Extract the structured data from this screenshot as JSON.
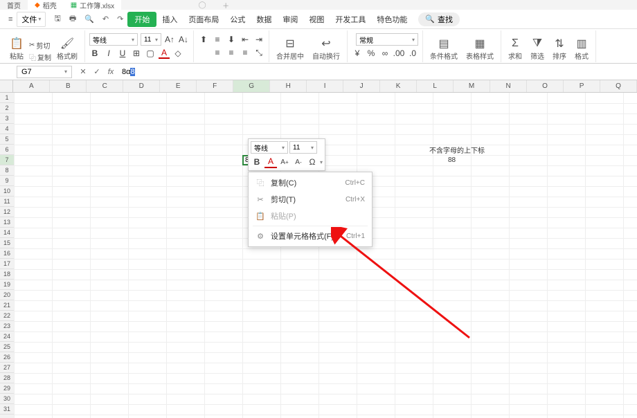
{
  "top_tabs": {
    "home": "首页",
    "daoke": "稻壳",
    "workbook": "工作簿.xlsx"
  },
  "menu": {
    "file": "文件",
    "start": "开始",
    "insert": "插入",
    "page_layout": "页面布局",
    "formulas": "公式",
    "data": "数据",
    "review": "审阅",
    "view": "视图",
    "dev_tools": "开发工具",
    "special": "特色功能",
    "search": "查找"
  },
  "ribbon": {
    "paste": "粘贴",
    "cut": "剪切",
    "copy": "复制",
    "format_painter": "格式刷",
    "font_name": "等线",
    "font_size": "11",
    "merge": "合并居中",
    "wrap": "自动换行",
    "number_format": "常规",
    "cond_format": "条件格式",
    "table_style": "表格样式",
    "sum": "求和",
    "filter": "筛选",
    "sort": "排序",
    "format": "格式"
  },
  "formula_bar": {
    "name_box": "G7",
    "fx": "fx",
    "content_prefix": "8α",
    "content_sel": "8"
  },
  "columns": [
    "A",
    "B",
    "C",
    "D",
    "E",
    "F",
    "G",
    "H",
    "I",
    "J",
    "K",
    "L",
    "M",
    "N",
    "O",
    "P",
    "Q"
  ],
  "active_col_index": 6,
  "active_row_index": 6,
  "cells": {
    "g7": "8α",
    "l6": "不含字母的上下标",
    "l7": "88"
  },
  "mini_toolbar": {
    "font_name": "等线",
    "font_size": "11"
  },
  "context_menu": {
    "copy": "复制(C)",
    "copy_kbd": "Ctrl+C",
    "cut": "剪切(T)",
    "cut_kbd": "Ctrl+X",
    "paste": "粘贴(P)",
    "format_cells": "设置单元格格式(F)...",
    "format_cells_kbd": "Ctrl+1"
  }
}
